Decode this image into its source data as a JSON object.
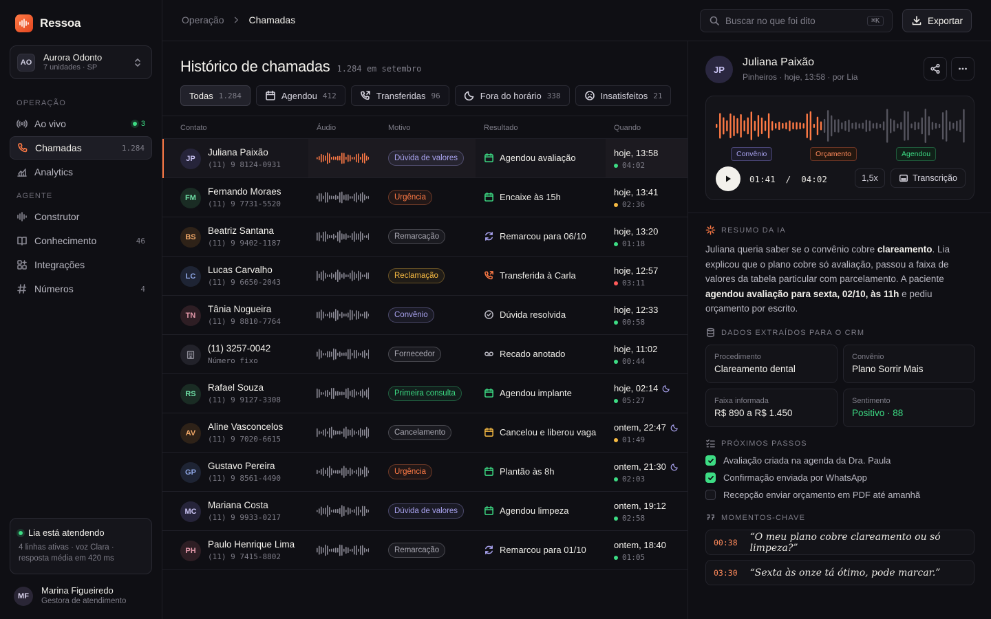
{
  "brand": {
    "name": "Ressoa"
  },
  "org": {
    "initials": "AO",
    "name": "Aurora Odonto",
    "sub": "7 unidades · SP"
  },
  "sidebar": {
    "section_operacao": "OPERAÇÃO",
    "section_agente": "AGENTE",
    "items": [
      {
        "label": "Ao vivo",
        "count": "3"
      },
      {
        "label": "Chamadas",
        "count": "1.284"
      },
      {
        "label": "Analytics",
        "count": ""
      },
      {
        "label": "Construtor",
        "count": ""
      },
      {
        "label": "Conhecimento",
        "count": "46"
      },
      {
        "label": "Integrações",
        "count": ""
      },
      {
        "label": "Números",
        "count": "4"
      }
    ]
  },
  "agent_status": {
    "title": "Lia está atendendo",
    "sub": "4 linhas ativas · voz Clara · resposta média em 420 ms"
  },
  "user": {
    "initials": "MF",
    "name": "Marina Figueiredo",
    "role": "Gestora de atendimento"
  },
  "breadcrumb": {
    "parent": "Operação",
    "current": "Chamadas"
  },
  "search": {
    "placeholder": "Buscar no que foi dito",
    "shortcut": "⌘K"
  },
  "export_label": "Exportar",
  "page": {
    "title": "Histórico de chamadas",
    "subtitle": "1.284 em setembro"
  },
  "filters": [
    {
      "label": "Todas",
      "count": "1.284"
    },
    {
      "label": "Agendou",
      "count": "412"
    },
    {
      "label": "Transferidas",
      "count": "96"
    },
    {
      "label": "Fora do horário",
      "count": "338"
    },
    {
      "label": "Insatisfeitos",
      "count": "21"
    }
  ],
  "table": {
    "headers": [
      "Contato",
      "Áudio",
      "Motivo",
      "Resultado",
      "Quando"
    ],
    "rows": [
      {
        "initials": "JP",
        "name": "Juliana Paixão",
        "phone": "(11) 9 8124-0931",
        "motivo": "Dúvida de valores",
        "mcolor": "#a9a3f0",
        "resultado": "Agendou avaliação",
        "ricon": "calendar",
        "rcolor": "#3ddc84",
        "when": "hoje, 13:58",
        "dur": "04:02",
        "dot": "#3ddc84",
        "moon": false,
        "avbg": "#26243a",
        "avfg": "#c9c3f3"
      },
      {
        "initials": "FM",
        "name": "Fernando Moraes",
        "phone": "(11) 9 7731-5520",
        "motivo": "Urgência",
        "mcolor": "#ff7a45",
        "resultado": "Encaixe às 15h",
        "ricon": "calendar",
        "rcolor": "#3ddc84",
        "when": "hoje, 13:41",
        "dur": "02:36",
        "dot": "#f5b942",
        "moon": false,
        "avbg": "#1a2c24",
        "avfg": "#6fe0a6"
      },
      {
        "initials": "BS",
        "name": "Beatriz Santana",
        "phone": "(11) 9 9402-1187",
        "motivo": "Remarcação",
        "mcolor": "#a9a8b2",
        "resultado": "Remarcou para 06/10",
        "ricon": "refresh",
        "rcolor": "#a9a3f0",
        "when": "hoje, 13:20",
        "dur": "01:18",
        "dot": "#3ddc84",
        "moon": false,
        "avbg": "#2e2218",
        "avfg": "#f0a868"
      },
      {
        "initials": "LC",
        "name": "Lucas Carvalho",
        "phone": "(11) 9 6650-2043",
        "motivo": "Reclamação",
        "mcolor": "#f5b942",
        "resultado": "Transferida à Carla",
        "ricon": "phone",
        "rcolor": "#ff7a45",
        "when": "hoje, 12:57",
        "dur": "03:11",
        "dot": "#ff5a5a",
        "moon": false,
        "avbg": "#1e2434",
        "avfg": "#8fa7e6"
      },
      {
        "initials": "TN",
        "name": "Tânia Nogueira",
        "phone": "(11) 9 8810-7764",
        "motivo": "Convênio",
        "mcolor": "#a9a3f0",
        "resultado": "Dúvida resolvida",
        "ricon": "check",
        "rcolor": "#b9b8c2",
        "when": "hoje, 12:33",
        "dur": "00:58",
        "dot": "#3ddc84",
        "moon": false,
        "avbg": "#2e1e24",
        "avfg": "#e59aab"
      },
      {
        "initials": "",
        "name": "(11) 3257-0042",
        "phone": "Número fixo",
        "motivo": "Fornecedor",
        "mcolor": "#a9a8b2",
        "resultado": "Recado anotado",
        "ricon": "voicemail",
        "rcolor": "#b9b8c2",
        "when": "hoje, 11:02",
        "dur": "00:44",
        "dot": "#3ddc84",
        "moon": false,
        "avbg": "#22222a",
        "avfg": "#8b8a95"
      },
      {
        "initials": "RS",
        "name": "Rafael Souza",
        "phone": "(11) 9 9127-3308",
        "motivo": "Primeira consulta",
        "mcolor": "#3ddc84",
        "resultado": "Agendou implante",
        "ricon": "calendar",
        "rcolor": "#3ddc84",
        "when": "hoje, 02:14",
        "dur": "05:27",
        "dot": "#3ddc84",
        "moon": true,
        "avbg": "#1a2c24",
        "avfg": "#6fe0a6"
      },
      {
        "initials": "AV",
        "name": "Aline Vasconcelos",
        "phone": "(11) 9 7020-6615",
        "motivo": "Cancelamento",
        "mcolor": "#a9a8b2",
        "resultado": "Cancelou e liberou vaga",
        "ricon": "calendar",
        "rcolor": "#f5b942",
        "when": "ontem, 22:47",
        "dur": "01:49",
        "dot": "#f5b942",
        "moon": true,
        "avbg": "#2e2218",
        "avfg": "#f0a868"
      },
      {
        "initials": "GP",
        "name": "Gustavo Pereira",
        "phone": "(11) 9 8561-4490",
        "motivo": "Urgência",
        "mcolor": "#ff7a45",
        "resultado": "Plantão às 8h",
        "ricon": "calendar",
        "rcolor": "#3ddc84",
        "when": "ontem, 21:30",
        "dur": "02:03",
        "dot": "#3ddc84",
        "moon": true,
        "avbg": "#1e2434",
        "avfg": "#8fa7e6"
      },
      {
        "initials": "MC",
        "name": "Mariana Costa",
        "phone": "(11) 9 9933-0217",
        "motivo": "Dúvida de valores",
        "mcolor": "#a9a3f0",
        "resultado": "Agendou limpeza",
        "ricon": "calendar",
        "rcolor": "#3ddc84",
        "when": "ontem, 19:12",
        "dur": "02:58",
        "dot": "#3ddc84",
        "moon": false,
        "avbg": "#26243a",
        "avfg": "#c9c3f3"
      },
      {
        "initials": "PH",
        "name": "Paulo Henrique Lima",
        "phone": "(11) 9 7415-8802",
        "motivo": "Remarcação",
        "mcolor": "#a9a8b2",
        "resultado": "Remarcou para 01/10",
        "ricon": "refresh",
        "rcolor": "#a9a3f0",
        "when": "ontem, 18:40",
        "dur": "01:05",
        "dot": "#3ddc84",
        "moon": false,
        "avbg": "#2e1e24",
        "avfg": "#e59aab"
      }
    ]
  },
  "detail": {
    "initials": "JP",
    "name": "Juliana Paixão",
    "meta": "Pinheiros · hoje, 13:58 · por Lia",
    "player": {
      "tags": [
        "Convênio",
        "Orçamento",
        "Agendou"
      ],
      "time": "01:41  /  04:02",
      "speed": "1,5x",
      "transcript_label": "Transcrição",
      "progress": 0.42
    },
    "summary_label": "RESUMO DA IA",
    "summary": {
      "p1": "Juliana queria saber se o convênio cobre ",
      "b1": "clareamento",
      "p2": ". Lia explicou que o plano cobre só avaliação, passou a faixa de valores da tabela particular com parcelamento. A paciente ",
      "b2": "agendou avaliação para sexta, 02/10, às 11h",
      "p3": " e pediu orçamento por escrito."
    },
    "crm_label": "DADOS EXTRAÍDOS PARA O CRM",
    "crm": [
      {
        "label": "Procedimento",
        "value": "Clareamento dental"
      },
      {
        "label": "Convênio",
        "value": "Plano Sorrir Mais"
      },
      {
        "label": "Faixa informada",
        "value": "R$ 890 a R$ 1.450"
      },
      {
        "label": "Sentimento",
        "value": "Positivo · 88"
      }
    ],
    "steps_label": "PRÓXIMOS PASSOS",
    "steps": [
      {
        "text": "Avaliação criada na agenda da Dra. Paula",
        "done": true
      },
      {
        "text": "Confirmação enviada por WhatsApp",
        "done": true
      },
      {
        "text": "Recepção enviar orçamento em PDF até amanhã",
        "done": false
      }
    ],
    "moments_label": "MOMENTOS-CHAVE",
    "moments": [
      {
        "ts": "00:38",
        "quote": "“O meu plano cobre clareamento ou só limpeza?”"
      },
      {
        "ts": "03:30",
        "quote": "“Sexta às onze tá ótimo, pode marcar.”"
      }
    ]
  },
  "colors": {
    "accent": "#ff7a45",
    "success": "#3ddc84",
    "warn": "#f5b942",
    "danger": "#ff5a5a",
    "violet": "#a9a3f0"
  }
}
